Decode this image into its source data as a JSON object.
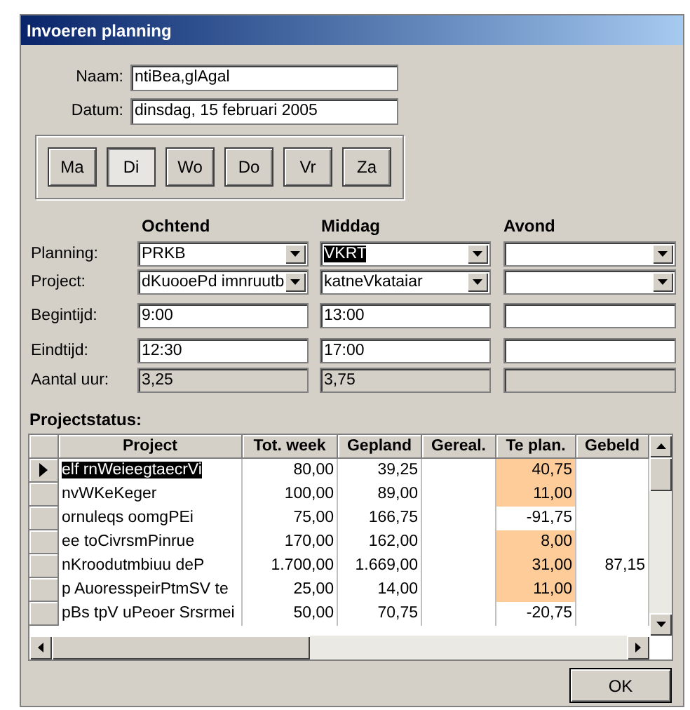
{
  "window": {
    "title": "Invoeren planning"
  },
  "fields": [
    {
      "label": "Naam:",
      "value": "ntiBea,glAgal"
    },
    {
      "label": "Datum:",
      "value": "dinsdag, 15 februari 2005"
    }
  ],
  "days": [
    {
      "label": "Ma",
      "selected": false
    },
    {
      "label": "Di",
      "selected": true
    },
    {
      "label": "Wo",
      "selected": false
    },
    {
      "label": "Do",
      "selected": false
    },
    {
      "label": "Vr",
      "selected": false
    },
    {
      "label": "Za",
      "selected": false
    }
  ],
  "columns": [
    "Ochtend",
    "Middag",
    "Avond"
  ],
  "form_rows": [
    {
      "label": "Planning:",
      "kind": "combo",
      "cells": [
        {
          "value": "PRKB",
          "text_selected": false
        },
        {
          "value": "VKRT",
          "text_selected": true
        }
      ]
    },
    {
      "label": "Project:",
      "kind": "combo",
      "cells": [
        {
          "value": "dKuooePd imnruutb",
          "text_selected": false
        },
        {
          "value": "katneVkataiar",
          "text_selected": false
        }
      ]
    },
    {
      "label": "Begintijd:",
      "kind": "text",
      "cells": [
        {
          "value": "9:00",
          "text_selected": false
        },
        {
          "value": "13:00",
          "text_selected": false
        }
      ]
    },
    {
      "label": "Eindtijd:",
      "kind": "text",
      "cells": [
        {
          "value": "12:30",
          "text_selected": false
        },
        {
          "value": "17:00",
          "text_selected": false
        }
      ]
    },
    {
      "label": "Aantal uur:",
      "kind": "readonly",
      "cells": [
        {
          "value": "3,25",
          "text_selected": false
        },
        {
          "value": "3,75",
          "text_selected": false
        }
      ]
    }
  ],
  "projectstatus": {
    "title": "Projectstatus:",
    "columns": [
      "Project",
      "Tot. week",
      "Gepland",
      "Gereal.",
      "Te plan.",
      "Gebeld"
    ],
    "rows": [
      {
        "selected": true,
        "highlighted": true,
        "cells": [
          "elf rnWeieegtaecrVi",
          "80,00",
          "39,25",
          "",
          "40,75",
          ""
        ]
      },
      {
        "selected": false,
        "highlighted": true,
        "cells": [
          "nvWKeKeger",
          "100,00",
          "89,00",
          "",
          "11,00",
          ""
        ]
      },
      {
        "selected": false,
        "highlighted": false,
        "cells": [
          "ornuleqs oomgPEi",
          "75,00",
          "166,75",
          "",
          "-91,75",
          ""
        ]
      },
      {
        "selected": false,
        "highlighted": true,
        "cells": [
          "ee toCivrsmPinrue",
          "170,00",
          "162,00",
          "",
          "8,00",
          ""
        ]
      },
      {
        "selected": false,
        "highlighted": true,
        "cells": [
          "nKroodutmbiuu deP",
          "1.700,00",
          "1.669,00",
          "",
          "31,00",
          "87,15"
        ]
      },
      {
        "selected": false,
        "highlighted": true,
        "cells": [
          "p  AuoresspeirPtmSV te",
          "25,00",
          "14,00",
          "",
          "11,00",
          ""
        ]
      },
      {
        "selected": false,
        "highlighted": false,
        "cells": [
          "pBs tpV uPeoer Srsrmei",
          "50,00",
          "70,75",
          "",
          "-20,75",
          ""
        ]
      }
    ]
  },
  "ok_button": {
    "label": "OK"
  }
}
